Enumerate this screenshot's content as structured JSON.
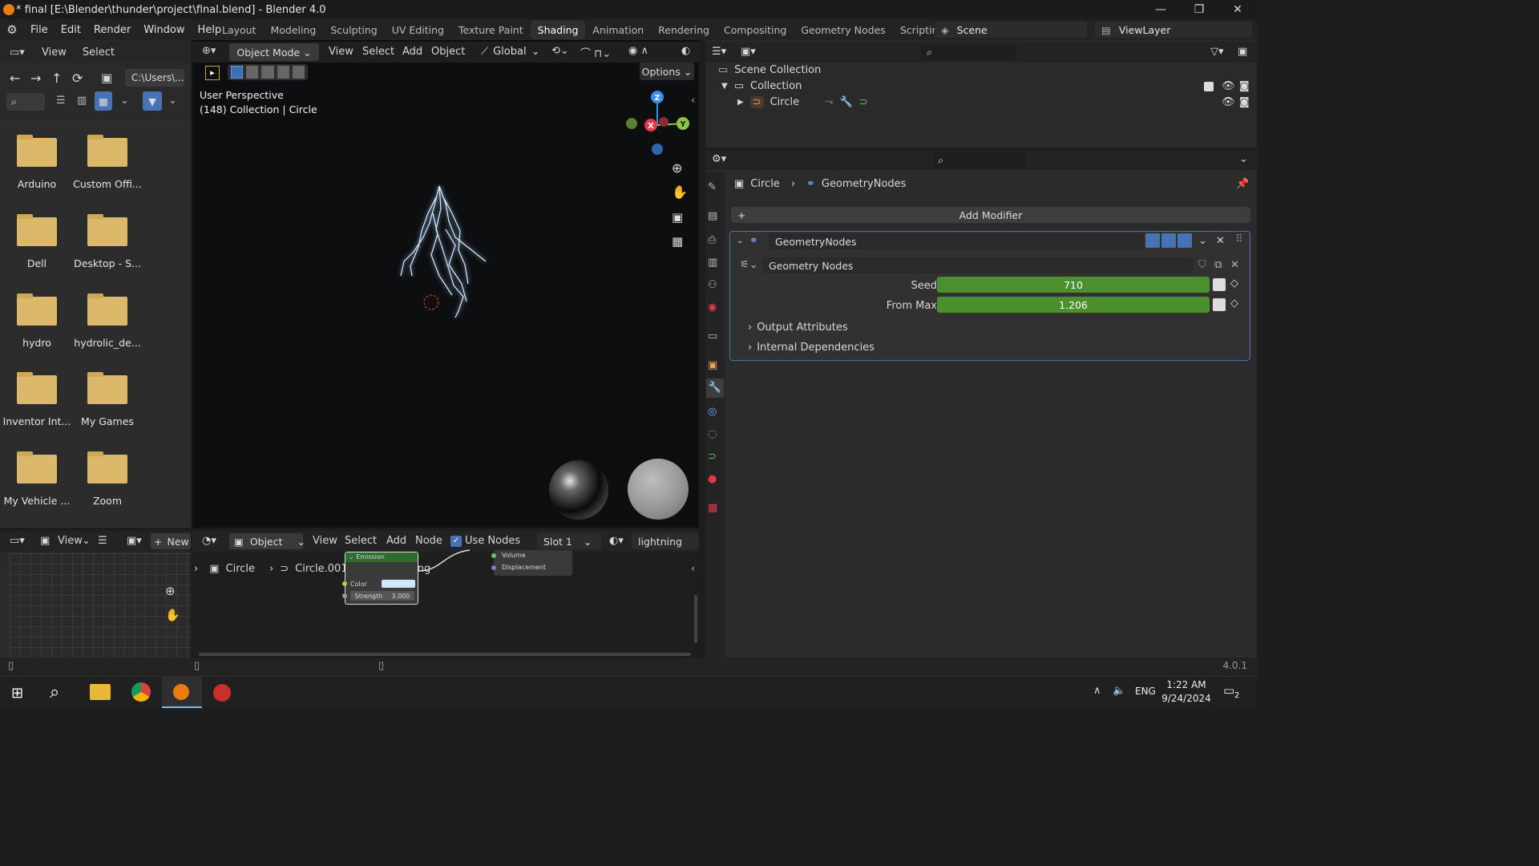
{
  "window": {
    "title": "* final [E:\\Blender\\thunder\\project\\final.blend] - Blender 4.0",
    "min": "—",
    "max": "❐",
    "close": "✕"
  },
  "menu": [
    "File",
    "Edit",
    "Render",
    "Window",
    "Help"
  ],
  "workspaces": [
    "Layout",
    "Modeling",
    "Sculpting",
    "UV Editing",
    "Texture Paint",
    "Shading",
    "Animation",
    "Rendering",
    "Compositing",
    "Geometry Nodes",
    "Scripting",
    "+"
  ],
  "scene": "Scene",
  "view_layer": "ViewLayer",
  "filebrowser": {
    "menu": [
      "View",
      "Select"
    ],
    "path": "C:\\Users\\...",
    "folders": [
      "Arduino",
      "Custom Offi...",
      "Dell",
      "Desktop - S...",
      "hydro",
      "hydrolic_de...",
      "Inventor Int...",
      "My Games",
      "My Vehicle ...",
      "Zoom"
    ]
  },
  "viewport": {
    "mode": "Object Mode",
    "menu": [
      "View",
      "Select",
      "Add",
      "Object"
    ],
    "transform": "Global",
    "options": "Options",
    "perspective": "User Perspective",
    "collection_info": "(148) Collection | Circle",
    "axes": {
      "x": "X",
      "y": "Y",
      "z": "Z"
    }
  },
  "outliner": {
    "scene_collection": "Scene Collection",
    "collection": "Collection",
    "object": "Circle"
  },
  "properties": {
    "breadcrumb_object": "Circle",
    "breadcrumb_modifier": "GeometryNodes",
    "add_modifier": "Add Modifier",
    "modifier_name": "GeometryNodes",
    "node_group": "Geometry Nodes",
    "seed_label": "Seed",
    "seed_value": "710",
    "frommax_label": "From Max",
    "frommax_value": "1.206",
    "output_attributes": "Output Attributes",
    "internal_deps": "Internal Dependencies"
  },
  "image_editor": {
    "view": "View",
    "new": "New"
  },
  "node_editor": {
    "object_type": "Object",
    "menu": [
      "View",
      "Select",
      "Add",
      "Node"
    ],
    "use_nodes": "Use Nodes",
    "slot": "Slot 1",
    "material": "lightning",
    "crumb_object": "Circle",
    "crumb_data": "Circle.001",
    "crumb_material": "lightning",
    "emission_title": "Emission",
    "emission_color": "Color",
    "emission_strength": "Strength",
    "emission_strength_value": "3.000",
    "output_volume": "Volume",
    "output_displacement": "Displacement"
  },
  "status": {
    "version": "4.0.1"
  },
  "taskbar": {
    "time": "1:22 AM",
    "date": "9/24/2024",
    "lang": "ENG",
    "notif": "2"
  },
  "colors": {
    "accent": "#4b8f2f",
    "x_axis": "#e2394c",
    "y_axis": "#8bc53f",
    "z_axis": "#3a8ee6"
  }
}
